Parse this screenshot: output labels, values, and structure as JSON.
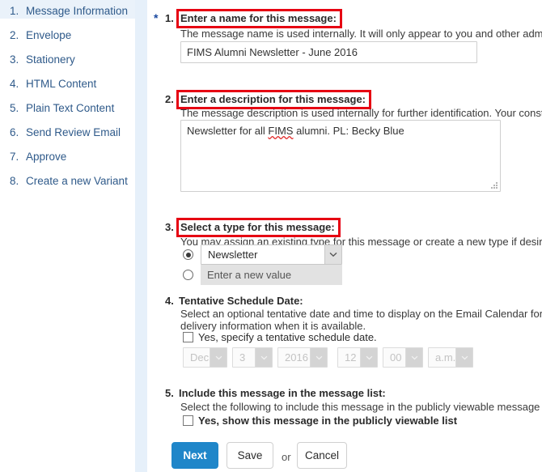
{
  "sidebar": {
    "items": [
      {
        "num": "1.",
        "label": "Message Information",
        "active": true
      },
      {
        "num": "2.",
        "label": "Envelope",
        "active": false
      },
      {
        "num": "3.",
        "label": "Stationery",
        "active": false
      },
      {
        "num": "4.",
        "label": "HTML Content",
        "active": false
      },
      {
        "num": "5.",
        "label": "Plain Text Content",
        "active": false
      },
      {
        "num": "6.",
        "label": "Send Review Email",
        "active": false
      },
      {
        "num": "7.",
        "label": "Approve",
        "active": false
      },
      {
        "num": "8.",
        "label": "Create a new Variant",
        "active": false
      }
    ]
  },
  "sections": {
    "name": {
      "required_marker": "*",
      "num": "1.",
      "heading": "Enter a name for this message:",
      "help": "The message name is used internally. It will only appear to you and other administrato",
      "value": "FIMS Alumni Newsletter - June 2016",
      "placeholder": ""
    },
    "description": {
      "num": "2.",
      "heading": "Enter a description for this message:",
      "help": "The message description is used internally for further identification. Your constituents",
      "value_before": "Newsletter for all ",
      "value_misspelled": "FIMS",
      "value_after": " alumni. PL: Becky Blue",
      "placeholder": ""
    },
    "type": {
      "num": "3.",
      "heading": "Select a type for this message:",
      "help": "You may assign an existing type for this message or create a new type if desired. Mess",
      "existing_selected": true,
      "existing_value": "Newsletter",
      "new_selected": false,
      "new_placeholder": "Enter a new value"
    },
    "schedule": {
      "num": "4.",
      "heading": "Tentative Schedule Date:",
      "help_line1": "Select an optional tentative date and time to display on the Email Calendar for this me",
      "help_line2": "delivery information when it is available.",
      "checkbox_label": "Yes, specify a tentative schedule date.",
      "checkbox_checked": false,
      "month": "Dec",
      "day": "3",
      "year": "2016",
      "hour": "12",
      "minute": "00",
      "meridiem": "a.m."
    },
    "include": {
      "num": "5.",
      "heading": "Include this message in the message list:",
      "help": "Select the following to include this message in the publicly viewable message list.",
      "checkbox_label": "Yes, show this message in the publicly viewable list",
      "checkbox_checked": false
    }
  },
  "actions": {
    "next_label": "Next",
    "save_label": "Save",
    "or_label": "or",
    "cancel_label": "Cancel"
  },
  "colors": {
    "primary_button": "#1f86c9",
    "annotation_box": "#e60012",
    "sidebar_active_bg": "#eaf2fa",
    "sidebar_band": "#e6f0fa",
    "sidebar_text": "#2f5a8a"
  }
}
